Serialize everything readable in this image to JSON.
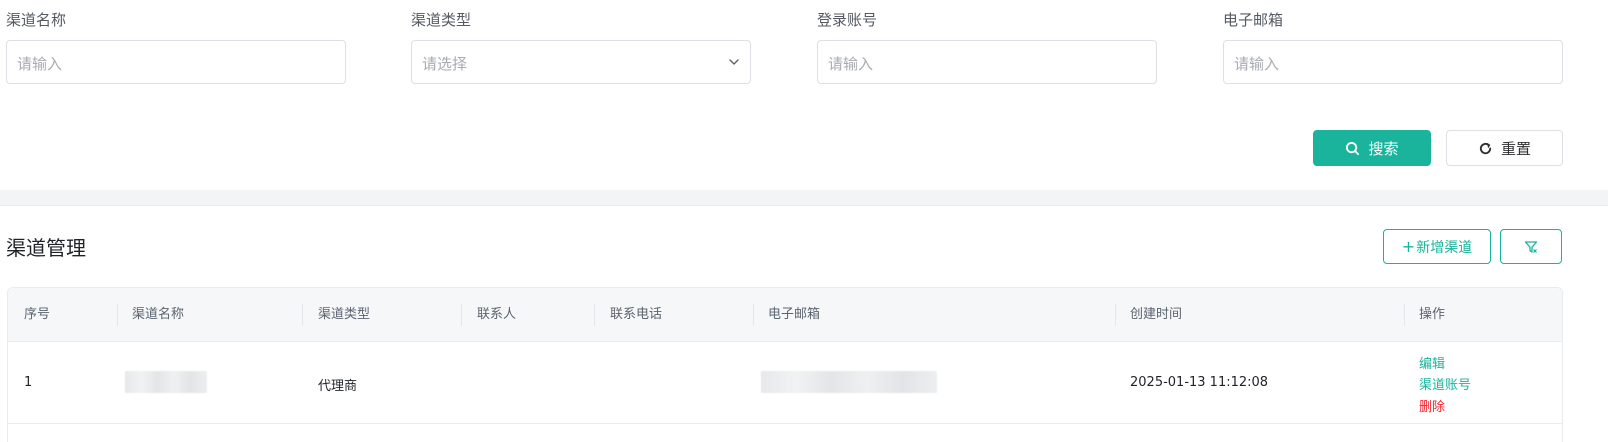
{
  "filters": [
    {
      "label": "渠道名称",
      "placeholder": "请输入",
      "type": "input"
    },
    {
      "label": "渠道类型",
      "placeholder": "请选择",
      "type": "select"
    },
    {
      "label": "登录账号",
      "placeholder": "请输入",
      "type": "input"
    },
    {
      "label": "电子邮箱",
      "placeholder": "请输入",
      "type": "input"
    }
  ],
  "actions": {
    "search_label": "搜索",
    "reset_label": "重置"
  },
  "panel": {
    "title": "渠道管理",
    "add_label": "新增渠道",
    "add_icon": "plus-icon",
    "filter_icon": "filter-icon"
  },
  "table": {
    "columns": [
      "序号",
      "渠道名称",
      "渠道类型",
      "联系人",
      "联系电话",
      "电子邮箱",
      "创建时间",
      "操作"
    ],
    "rows": [
      {
        "index": "1",
        "name": "",
        "type": "代理商",
        "contact": "",
        "phone": "",
        "email": "",
        "created": "2025-01-13 11:12:08",
        "ops": {
          "edit": "编辑",
          "accounts": "渠道账号",
          "delete": "删除"
        }
      }
    ]
  },
  "colors": {
    "primary": "#1ab39b",
    "danger": "#f5222d",
    "border": "#dcdfe6",
    "header_bg": "#f5f7f9"
  }
}
